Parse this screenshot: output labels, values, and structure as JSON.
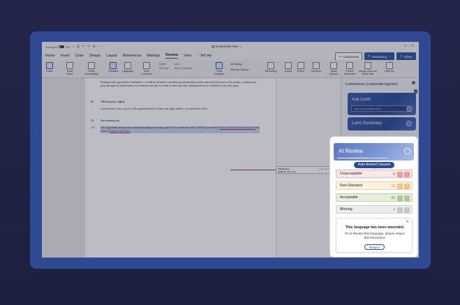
{
  "titlebar": {
    "autosave_label": "AutoSave",
    "autosave_state": "Off",
    "document_title": "DreamPark NDA"
  },
  "menu": {
    "items": [
      "Home",
      "Insert",
      "Draw",
      "Design",
      "Layout",
      "References",
      "Mailings",
      "Review",
      "View",
      "Tell me"
    ],
    "active": "Review",
    "comments_label": "Comments",
    "reviewing_label": "Reviewing",
    "share_label": "Share"
  },
  "ribbon": {
    "editor": "Editor",
    "read_aloud": "Read Aloud",
    "check_accessibility": "Check Accessibility",
    "translate": "Translate",
    "language": "Language",
    "new_comment": "New Comment",
    "delete": "Delete",
    "previous": "Previous",
    "next": "Next",
    "show_comments": "Show Comments",
    "track_changes": "Track Changes",
    "all_markup": "All Markup",
    "markup_options": "Mark-up Options",
    "reviewing_pane": "Reviewing",
    "accept": "Accept",
    "reject": "Reject",
    "compare": "Compare",
    "block_authors": "Block Authors",
    "protect_document": "Protect Document",
    "always_open_read_only": "Always Open as Read-only",
    "hide_ink": "Hide Ink"
  },
  "document": {
    "para_top": "Nothing in this agreement is intended to, or shall be deemed to, establish any partnership or joint venture between any of the parties, constitute any party the agent of another party, nor authorise any party to make or enter into any commitments for or on behalf of any other party.",
    "section_11_num": "11.",
    "section_11_title": "Third party rights",
    "section_11_text": "A person who is not a party to this agreement shall not have any rights under or in connection with it.",
    "section_12_num": "12.",
    "section_12_title": "Governing law",
    "clause_12_1_num": "12.1",
    "clause_12_1_text_a": "This Agreement and any non-contractual obligations arising out of or in connection with it shall be governed by",
    "clause_12_1_inserted": "and construed in accordance with",
    "clause_12_1_text_b": "the Laws of",
    "clause_12_1_place": "England and Wales"
  },
  "comment": {
    "author": "Ella Bishop",
    "action": "Deleted:",
    "deleted_text": "New York",
    "time": "A few seconds ago"
  },
  "sidebar": {
    "title": "Luminance (corporate-kgxom)",
    "ask_title": "Ask Lumi",
    "ask_placeholder": "Type your question here...",
    "summary_title": "Lumi Summary"
  },
  "ai_review": {
    "title": "AI Review",
    "progress": 0.62,
    "auto_amend_label": "Auto Amend Clauses",
    "categories": [
      {
        "label": "Unacceptable",
        "count": "6"
      },
      {
        "label": "Non-Standard",
        "count": "12"
      },
      {
        "label": "Acceptable",
        "count": "63"
      },
      {
        "label": "Missing",
        "count": "7"
      }
    ],
    "notice": {
      "title": "This language has been amended.",
      "body": "To AI Review this language, please resync this Document.",
      "resync_label": "Resync"
    }
  },
  "colors": {
    "brand": "#2b4a92",
    "unacceptable": "#c0392b",
    "non_standard": "#c77d17",
    "acceptable": "#4d7a2e",
    "missing": "#555555"
  }
}
